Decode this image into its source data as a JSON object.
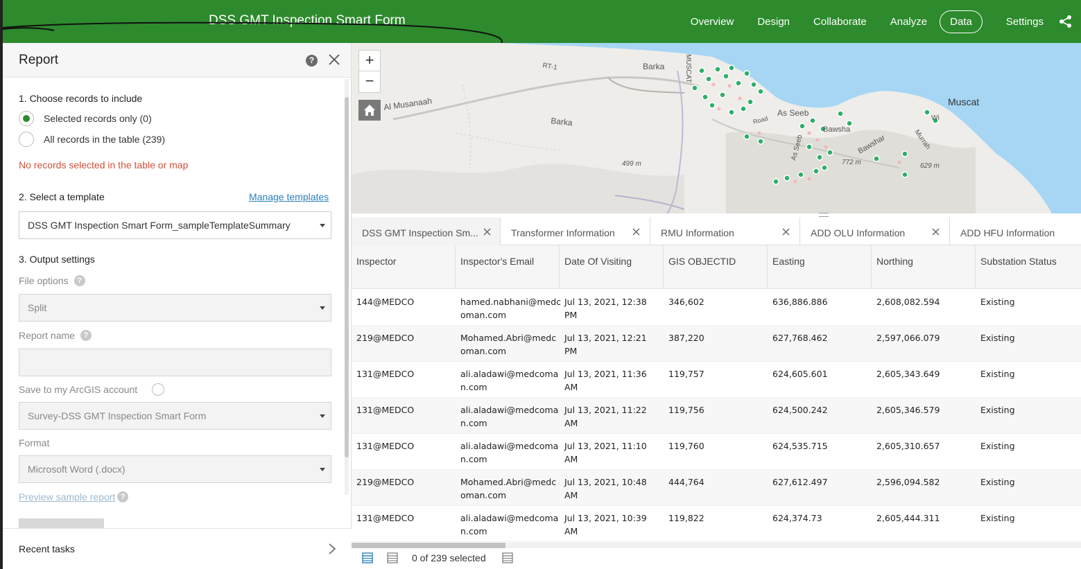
{
  "header": {
    "title": "DSS GMT Inspection Smart Form",
    "nav": [
      "Overview",
      "Design",
      "Collaborate",
      "Analyze",
      "Data",
      "Settings"
    ],
    "active_tab": "Data"
  },
  "colors": {
    "brand": "#2d8a2d",
    "warning": "#d1503a",
    "link": "#2b7fbc",
    "water": "#a6d6f4"
  },
  "report": {
    "title": "Report",
    "section1": "1. Choose records to include",
    "option_selected": "Selected records only (0)",
    "option_all": "All records in the table (239)",
    "warning": "No records selected in the table or map",
    "section2": "2. Select a template",
    "manage_templates": "Manage templates",
    "template_value": "DSS GMT Inspection Smart Form_sampleTemplateSummary",
    "section3": "3. Output settings",
    "file_options_label": "File options",
    "file_options_value": "Split",
    "report_name_label": "Report name",
    "save_label": "Save to my ArcGIS account",
    "survey_value": "Survey-DSS GMT Inspection Smart Form",
    "format_label": "Format",
    "format_value": "Microsoft Word (.docx)",
    "preview_link": "Preview sample report",
    "recent_tasks": "Recent tasks"
  },
  "map": {
    "labels": [
      "Barka",
      "Al Musanaah",
      "Barka",
      "RT-1",
      "MUSCAT",
      "As Seeb",
      "Bawshar",
      "Muscat",
      "499 m",
      "772 m",
      "629 m",
      "Bawsha",
      "Murrah",
      "Wi",
      "Road",
      "As Seeb"
    ]
  },
  "tabs": [
    {
      "label": "DSS GMT Inspection Sm...",
      "active": true
    },
    {
      "label": "Transformer Information",
      "active": false
    },
    {
      "label": "RMU Information",
      "active": false
    },
    {
      "label": "ADD OLU Information",
      "active": false
    },
    {
      "label": "ADD HFU Information",
      "active": false
    }
  ],
  "table": {
    "columns": [
      "Inspector",
      "Inspector's Email",
      "Date Of Visiting",
      "GIS OBJECTID",
      "Easting",
      "Northing",
      "Substation Status"
    ],
    "rows": [
      [
        "144@MEDCO",
        "hamed.nabhani@medc",
        "oman.com",
        "Jul 13, 2021, 12:38",
        "PM",
        "346,602",
        "636,886.886",
        "2,608,082.594",
        "Existing"
      ],
      [
        "219@MEDCO",
        "Mohamed.Abri@medc",
        "oman.com",
        "Jul 13, 2021, 12:21",
        "PM",
        "387,220",
        "627,768.462",
        "2,597,066.079",
        "Existing"
      ],
      [
        "131@MEDCO",
        "ali.aladawi@medcoma",
        "n.com",
        "Jul 13, 2021, 11:36",
        "AM",
        "119,757",
        "624,605.601",
        "2,605,343.649",
        "Existing"
      ],
      [
        "131@MEDCO",
        "ali.aladawi@medcoma",
        "n.com",
        "Jul 13, 2021, 11:22",
        "AM",
        "119,756",
        "624,500.242",
        "2,605,346.579",
        "Existing"
      ],
      [
        "131@MEDCO",
        "ali.aladawi@medcoma",
        "n.com",
        "Jul 13, 2021, 11:10",
        "AM",
        "119,760",
        "624,535.715",
        "2,605,310.657",
        "Existing"
      ],
      [
        "219@MEDCO",
        "Mohamed.Abri@medc",
        "oman.com",
        "Jul 13, 2021, 10:48",
        "AM",
        "444,764",
        "627,612.497",
        "2,596,094.582",
        "Existing"
      ],
      [
        "131@MEDCO",
        "ali.aladawi@medcoma",
        "n.com",
        "Jul 13, 2021, 10:39",
        "AM",
        "119,822",
        "624,374.73",
        "2,605,444.311",
        "Existing"
      ]
    ]
  },
  "footer": {
    "selection": "0 of 239 selected"
  }
}
